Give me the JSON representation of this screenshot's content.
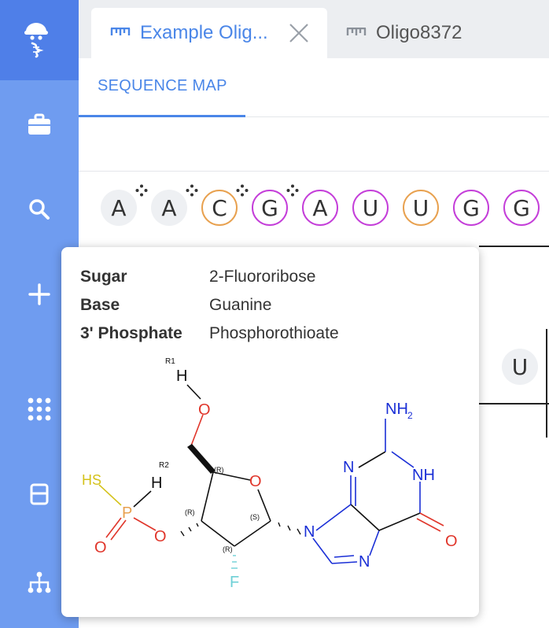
{
  "sidebar": {
    "items": [
      {
        "icon": "oligo-robot-icon"
      },
      {
        "icon": "briefcase-icon"
      },
      {
        "icon": "search-icon"
      },
      {
        "icon": "plus-icon"
      },
      {
        "icon": "grid-dots-icon"
      },
      {
        "icon": "layout-icon"
      },
      {
        "icon": "hierarchy-icon"
      }
    ]
  },
  "tabs": [
    {
      "label": "Example Olig...",
      "active": true,
      "icon": "ruler-icon"
    },
    {
      "label": "Oligo8372",
      "active": false,
      "icon": "ruler-icon"
    }
  ],
  "subnav": {
    "label": "SEQUENCE MAP"
  },
  "sequence": [
    {
      "letter": "A",
      "style": "plain",
      "modified": true
    },
    {
      "letter": "A",
      "style": "plain",
      "modified": true
    },
    {
      "letter": "C",
      "style": "orange",
      "modified": true
    },
    {
      "letter": "G",
      "style": "purple",
      "modified": true
    },
    {
      "letter": "A",
      "style": "purple",
      "modified": false
    },
    {
      "letter": "U",
      "style": "purple",
      "modified": false
    },
    {
      "letter": "U",
      "style": "orange",
      "modified": false
    },
    {
      "letter": "G",
      "style": "purple",
      "modified": false
    },
    {
      "letter": "G",
      "style": "purple",
      "modified": false
    }
  ],
  "second_strand": {
    "visible_letter": "U"
  },
  "tooltip": {
    "rows": [
      {
        "key": "Sugar",
        "value": "2-Fluororibose"
      },
      {
        "key": "Base",
        "value": "Guanine"
      },
      {
        "key": "3' Phosphate",
        "value": "Phosphorothioate"
      }
    ],
    "structure_labels": {
      "r1": "R1",
      "h1": "H",
      "o_top": "O",
      "hs": "HS",
      "r2": "R2",
      "h2": "H",
      "p": "P",
      "o_left": "O",
      "o_ester": "O",
      "o_ring": "O",
      "r_a": "(R)",
      "r_b": "(R)",
      "s": "(S)",
      "r_c": "(R)",
      "f": "F",
      "n1": "N",
      "n2": "N",
      "n3": "N",
      "nh": "NH",
      "nh2": "NH",
      "nh2_sub": "2",
      "o_keto": "O"
    }
  },
  "colors": {
    "sidebar": "#6f9cf0",
    "sidebar_active": "#4f7fe8",
    "accent": "#4a86e8",
    "orange": "#e8a14f",
    "purple": "#c43ed9",
    "oxygen": "#e0362b",
    "nitrogen": "#1a2fd6",
    "phosphorus": "#e8a14f",
    "sulfur": "#d4c21a",
    "fluorine": "#6ed0d6"
  }
}
